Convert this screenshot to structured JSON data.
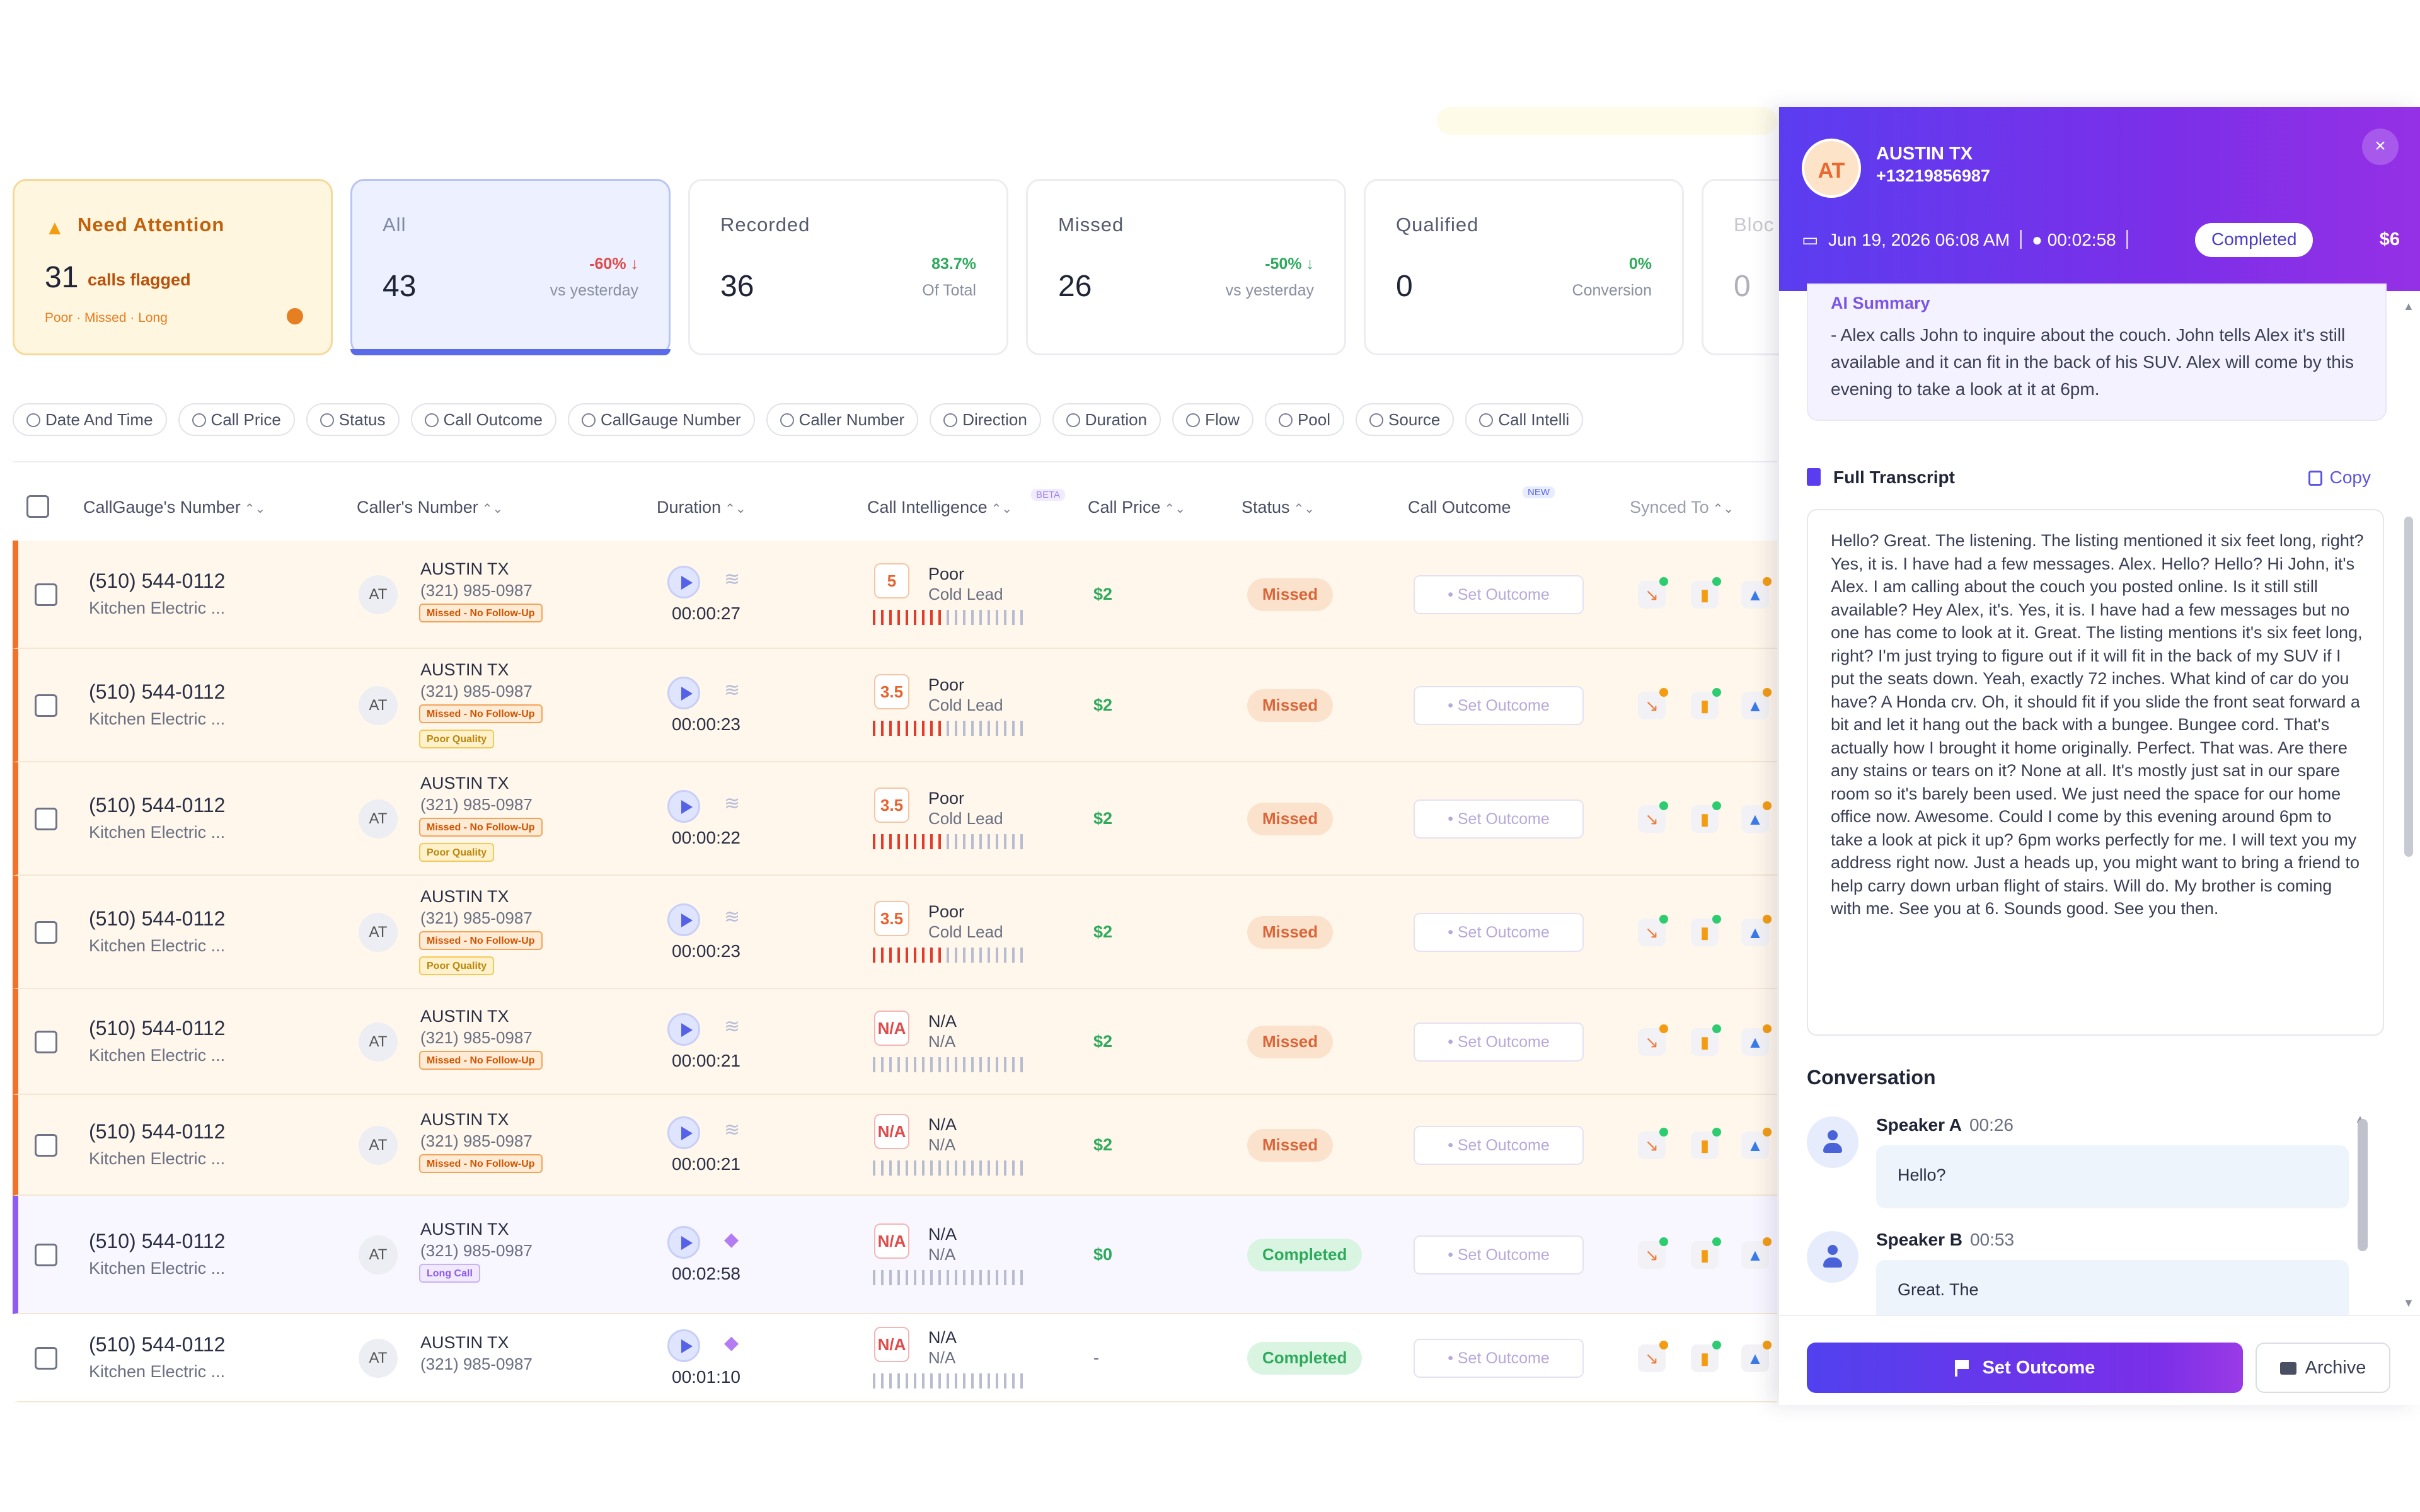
{
  "cards": [
    {
      "id": "attention",
      "label": "Need Attention",
      "value": "31",
      "flagged": "calls flagged",
      "tags": "Poor · Missed · Long"
    },
    {
      "id": "all",
      "label": "All",
      "value": "43",
      "pct": "-60% ↓",
      "sub": "vs yesterday"
    },
    {
      "id": "recorded",
      "label": "Recorded",
      "value": "36",
      "pct": "83.7%",
      "sub": "Of Total"
    },
    {
      "id": "missed",
      "label": "Missed",
      "value": "26",
      "pct": "-50% ↓",
      "sub": "vs yesterday"
    },
    {
      "id": "qualified",
      "label": "Qualified",
      "value": "0",
      "pct": "0%",
      "sub": "Conversion"
    },
    {
      "id": "blocked",
      "label": "Bloc",
      "value": "0"
    }
  ],
  "filters": [
    "Date And Time",
    "Call Price",
    "Status",
    "Call Outcome",
    "CallGauge Number",
    "Caller Number",
    "Direction",
    "Duration",
    "Flow",
    "Pool",
    "Source",
    "Call Intelli"
  ],
  "columns": {
    "callgauge": "CallGauge's Number",
    "caller": "Caller's Number",
    "duration": "Duration",
    "intelligence": "Call Intelligence",
    "beta": "BETA",
    "price": "Call Price",
    "status": "Status",
    "outcome": "Call Outcome",
    "outcome_badge": "NEW",
    "synced": "Synced To"
  },
  "rows": [
    {
      "number": "(510) 544-0112",
      "biz": "Kitchen Electric ...",
      "initials": "AT",
      "city": "AUSTIN TX",
      "phone": "(321) 985-0987",
      "tags": [
        "Missed - No Follow-Up"
      ],
      "duration": "00:00:27",
      "score": "5",
      "quality": "Poor",
      "lead": "Cold Lead",
      "price": "$2",
      "status": "Missed",
      "outcome": "• Set Outcome"
    },
    {
      "number": "(510) 544-0112",
      "biz": "Kitchen Electric ...",
      "initials": "AT",
      "city": "AUSTIN TX",
      "phone": "(321) 985-0987",
      "tags": [
        "Missed - No Follow-Up",
        "Poor Quality"
      ],
      "duration": "00:00:23",
      "score": "3.5",
      "quality": "Poor",
      "lead": "Cold Lead",
      "price": "$2",
      "status": "Missed",
      "outcome": "• Set Outcome"
    },
    {
      "number": "(510) 544-0112",
      "biz": "Kitchen Electric ...",
      "initials": "AT",
      "city": "AUSTIN TX",
      "phone": "(321) 985-0987",
      "tags": [
        "Missed - No Follow-Up",
        "Poor Quality"
      ],
      "duration": "00:00:22",
      "score": "3.5",
      "quality": "Poor",
      "lead": "Cold Lead",
      "price": "$2",
      "status": "Missed",
      "outcome": "• Set Outcome"
    },
    {
      "number": "(510) 544-0112",
      "biz": "Kitchen Electric ...",
      "initials": "AT",
      "city": "AUSTIN TX",
      "phone": "(321) 985-0987",
      "tags": [
        "Missed - No Follow-Up",
        "Poor Quality"
      ],
      "duration": "00:00:23",
      "score": "3.5",
      "quality": "Poor",
      "lead": "Cold Lead",
      "price": "$2",
      "status": "Missed",
      "outcome": "• Set Outcome"
    },
    {
      "number": "(510) 544-0112",
      "biz": "Kitchen Electric ...",
      "initials": "AT",
      "city": "AUSTIN TX",
      "phone": "(321) 985-0987",
      "tags": [
        "Missed - No Follow-Up"
      ],
      "duration": "00:00:21",
      "score": "N/A",
      "quality": "N/A",
      "lead": "N/A",
      "price": "$2",
      "status": "Missed",
      "outcome": "• Set Outcome"
    },
    {
      "number": "(510) 544-0112",
      "biz": "Kitchen Electric ...",
      "initials": "AT",
      "city": "AUSTIN TX",
      "phone": "(321) 985-0987",
      "tags": [
        "Missed - No Follow-Up"
      ],
      "duration": "00:00:21",
      "score": "N/A",
      "quality": "N/A",
      "lead": "N/A",
      "price": "$2",
      "status": "Missed",
      "outcome": "• Set Outcome"
    },
    {
      "number": "(510) 544-0112",
      "biz": "Kitchen Electric ...",
      "initials": "AT",
      "city": "AUSTIN TX",
      "phone": "(321) 985-0987",
      "tags": [
        "Long Call"
      ],
      "duration": "00:02:58",
      "score": "N/A",
      "quality": "N/A",
      "lead": "N/A",
      "price": "$0",
      "status": "Completed",
      "outcome": "• Set Outcome"
    },
    {
      "number": "(510) 544-0112",
      "biz": "Kitchen Electric ...",
      "initials": "AT",
      "city": "AUSTIN TX",
      "phone": "(321) 985-0987",
      "tags": [],
      "duration": "00:01:10",
      "score": "N/A",
      "quality": "N/A",
      "lead": "N/A",
      "price": "-",
      "status": "Completed",
      "outcome": "• Set Outcome"
    }
  ],
  "panel": {
    "initials": "AT",
    "title": "AUSTIN TX",
    "phone": "+13219856987",
    "date": "Jun 19, 2026 06:08 AM",
    "duration": "00:02:58",
    "status": "Completed",
    "price": "$6",
    "close": "×",
    "ai_heading": "AI Summary",
    "ai_text": "- Alex calls John to inquire about the couch. John tells Alex it's still available and it can fit in the back of his SUV. Alex will come by this evening to take a look at it at 6pm.",
    "transcript_heading": "Full Transcript",
    "copy_label": "Copy",
    "transcript": "Hello? Great. The listening. The listing mentioned it six feet long, right? Yes, it is. I have had a few messages. Alex. Hello? Hello? Hi John, it's Alex. I am calling about the couch you posted online. Is it still still available? Hey Alex, it's. Yes, it is. I have had a few messages but no one has come to look at it. Great. The listing mentions it's six feet long, right? I'm just trying to figure out if it will fit in the back of my SUV if I put the seats down. Yeah, exactly 72 inches. What kind of car do you have? A Honda crv. Oh, it should fit if you slide the front seat forward a bit and let it hang out the back with a bungee. Bungee cord. That's actually how I brought it home originally. Perfect. That was. Are there any stains or tears on it? None at all. It's mostly just sat in our spare room so it's barely been used. We just need the space for our home office now. Awesome. Could I come by this evening around 6pm to take a look at pick it up? 6pm works perfectly for me. I will text you my address right now. Just a heads up, you might want to bring a friend to help carry down urban flight of stairs. Will do. My brother is coming with me. See you at 6. Sounds good. See you then.",
    "conversation_heading": "Conversation",
    "messages": [
      {
        "speaker": "Speaker A",
        "time": "00:26",
        "text": "Hello?"
      },
      {
        "speaker": "Speaker B",
        "time": "00:53",
        "text": "Great. The"
      }
    ],
    "set_outcome": "Set Outcome",
    "archive": "Archive"
  },
  "colors": {
    "accent": "#5b3df0",
    "missed": "#f2722b",
    "completed": "#8e5cf0",
    "success": "#2eaa5c",
    "danger": "#e04a4a"
  }
}
